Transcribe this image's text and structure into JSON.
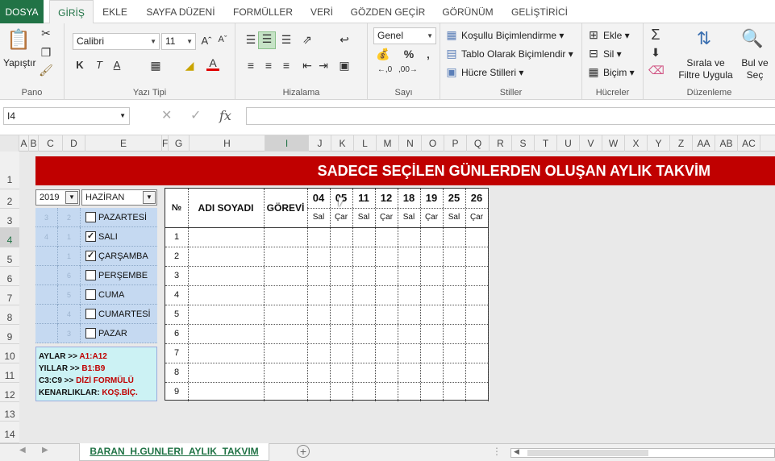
{
  "ribbon_tabs": [
    "DOSYA",
    "GİRİŞ",
    "EKLE",
    "SAYFA DÜZENİ",
    "FORMÜLLER",
    "VERİ",
    "GÖZDEN GEÇİR",
    "GÖRÜNÜM",
    "GELİŞTİRİCİ"
  ],
  "ribbon": {
    "paste_label": "Yapıştır",
    "font_name": "Calibri",
    "font_size": "11",
    "number_format": "Genel",
    "conditional_formatting": "Koşullu Biçimlendirme",
    "format_as_table": "Tablo Olarak Biçimlendir",
    "cell_styles": "Hücre Stilleri",
    "insert": "Ekle",
    "delete": "Sil",
    "format": "Biçim",
    "sort_filter": "Sırala ve Filtre Uygula",
    "find_select": "Bul ve Seç",
    "groups": {
      "clipboard": "Pano",
      "font": "Yazı Tipi",
      "alignment": "Hizalama",
      "number": "Sayı",
      "styles": "Stiller",
      "cells": "Hücreler",
      "editing": "Düzenleme"
    }
  },
  "formula_bar": {
    "name_box": "I4",
    "fx": "fx",
    "formula": ""
  },
  "columns": [
    "A",
    "B",
    "C",
    "D",
    "E",
    "F",
    "G",
    "H",
    "I",
    "J",
    "K",
    "L",
    "M",
    "N",
    "O",
    "P",
    "Q",
    "R",
    "S",
    "T",
    "U",
    "V",
    "W",
    "X",
    "Y",
    "Z",
    "AA",
    "AB",
    "AC"
  ],
  "rows": [
    "1",
    "2",
    "3",
    "4",
    "5",
    "6",
    "7",
    "8",
    "9",
    "10",
    "11",
    "12",
    "13",
    "14"
  ],
  "sheet": {
    "banner_title": "SADECE SEÇİLEN GÜNLERDEN OLUŞAN AYLIK TAKVİM",
    "year": "2019",
    "month": "HAZİRAN",
    "days": [
      {
        "c": "3",
        "d": "2",
        "label": "PAZARTESİ",
        "checked": false
      },
      {
        "c": "4",
        "d": "1",
        "label": "SALI",
        "checked": true
      },
      {
        "c": "",
        "d": "1",
        "label": "ÇARŞAMBA",
        "checked": true
      },
      {
        "c": "",
        "d": "6",
        "label": "PERŞEMBE",
        "checked": false
      },
      {
        "c": "",
        "d": "5",
        "label": "CUMA",
        "checked": false
      },
      {
        "c": "",
        "d": "4",
        "label": "CUMARTESİ",
        "checked": false
      },
      {
        "c": "",
        "d": "3",
        "label": "PAZAR",
        "checked": false
      }
    ],
    "notes": [
      {
        "key": "AYLAR >> ",
        "value": "A1:A12"
      },
      {
        "key": "YILLAR >> ",
        "value": "B1:B9"
      },
      {
        "key": "C3:C9 >> ",
        "value": "DİZİ FORMÜLÜ"
      },
      {
        "key": "KENARLIKLAR: ",
        "value": "KOŞ.BİÇ."
      }
    ],
    "table": {
      "no_header": "№",
      "name_header": "ADI SOYADI",
      "role_header": "GÖREVİ",
      "dates": [
        "04",
        "05",
        "11",
        "12",
        "18",
        "19",
        "25",
        "26"
      ],
      "weekdays": [
        "Sal",
        "Çar",
        "Sal",
        "Çar",
        "Sal",
        "Çar",
        "Sal",
        "Çar"
      ],
      "row_numbers": [
        "1",
        "2",
        "3",
        "4",
        "5",
        "6",
        "7",
        "8",
        "9"
      ]
    }
  },
  "sheet_tab": "BARAN_H.GUNLERI_AYLIK_TAKVIM",
  "colors": {
    "excel_green": "#217346",
    "banner_red": "#c00000",
    "day_panel": "#c5d9f1",
    "notes_bg": "#ccf2f4"
  }
}
